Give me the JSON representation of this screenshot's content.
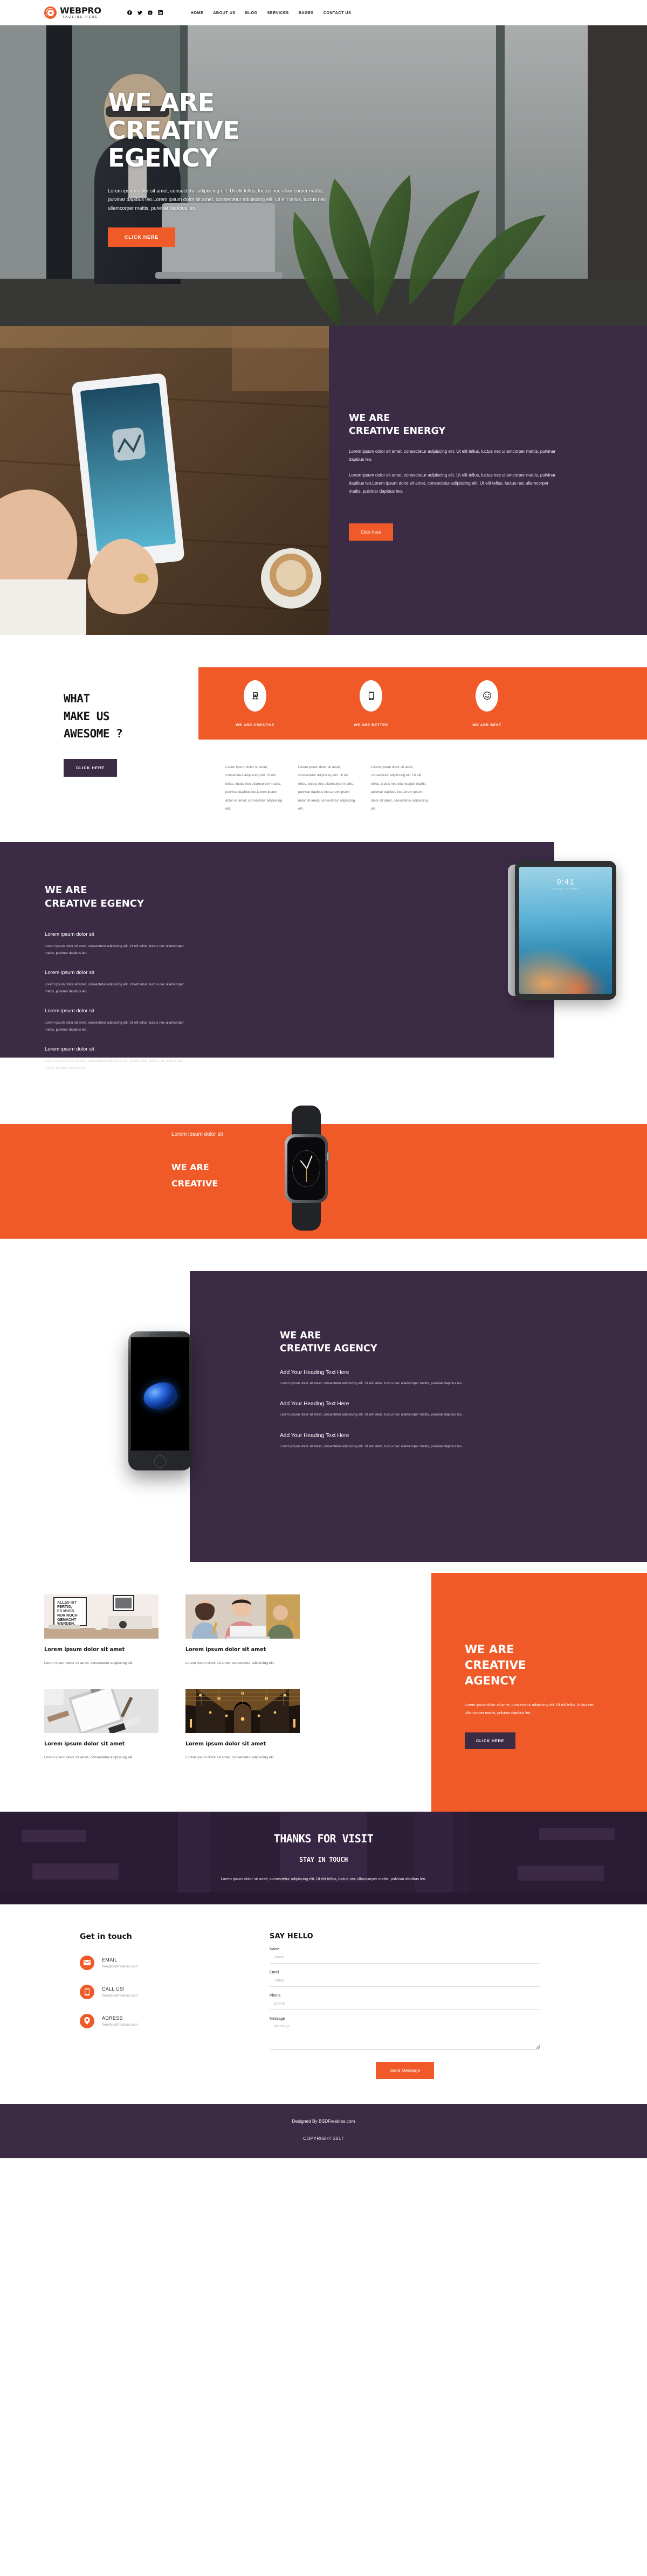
{
  "brand": {
    "name": "WEBPRO",
    "tagline": "TAGLINE HERE",
    "accent": "#f05a28",
    "dark": "#3b2b45"
  },
  "header": {
    "social": [
      "facebook-icon",
      "twitter-icon",
      "skype-icon",
      "linkedin-icon"
    ],
    "nav": [
      "HOME",
      "ABOUT US",
      "BLOG",
      "SERVICES",
      "BAGES",
      "CONTACT US"
    ]
  },
  "hero": {
    "line1": "WE ARE",
    "line2": "CREATIVE",
    "line3": "EGENCY",
    "paragraph": "Lorem ipsum dolor sit amet, consectetur adipiscing elit. Ut elit tellus, luctus nec ullamcorper mattis, pulvinar dapibus leo.Lorem ipsum dolor sit amet, consectetur adipiscing elit. Ut elit tellus, luctus nec ullamcorper mattis, pulvinar dapibus leo.",
    "button": "CLICK HERE"
  },
  "split": {
    "title_line1": "WE ARE",
    "title_line2": "CREATIVE ENERGY",
    "p1": "Lorem ipsum dolor sit amet, consectetur adipiscing elit. Ut elit tellus, luctus nec ullamcorper mattis, pulvinar dapibus leo.",
    "p2": "Lorem ipsum dolor sit amet, consectetur adipiscing elit. Ut elit tellus, luctus nec ullamcorper mattis, pulvinar dapibus leo.Lorem ipsum dolor sit amet, consectetur adipiscing elit. Ut elit tellus, luctus nec ullamcorper mattis, pulvinar dapibus leo.",
    "button": "Click here"
  },
  "awesome": {
    "title_line1": "WHAT",
    "title_line2": "MAKE US",
    "title_line3": "AWESOME ?",
    "button": "CLICK HERE",
    "features": [
      {
        "icon": "train-icon",
        "label": "WE ARE CREATIVE",
        "text": "Lorem ipsum dolor sit amet, consectetur adipiscing elit. Ut elit tellus, luctus nec ullamcorper mattis, pulvinar dapibus leo.Lorem ipsum dolor sit amet, consectetur adipiscing elit."
      },
      {
        "icon": "mobile-icon",
        "label": "WE ARE BETTER",
        "text": "Lorem ipsum dolor sit amet, consectetur adipiscing elit. Ut elit tellus, luctus nec ullamcorper mattis, pulvinar dapibus leo.Lorem ipsum dolor sit amet, consectetur adipiscing elit."
      },
      {
        "icon": "smiley-icon",
        "label": "WE ARE BEST",
        "text": "Lorem ipsum dolor sit amet, consectetur adipiscing elit. Ut elit tellus, luctus nec ullamcorper mattis, pulvinar dapibus leo.Lorem ipsum dolor sit amet, consectetur adipiscing elit."
      }
    ]
  },
  "egency": {
    "title_line1": "WE ARE",
    "title_line2": "CREATIVE EGENCY",
    "cells": [
      {
        "heading": "Lorem ipsum dolor sit",
        "text": "Lorem ipsum dolor sit amet, consectetur adipiscing elit. Ut elit tellus, luctus nec ullamcorper mattis, pulvinar dapibus leo."
      },
      {
        "heading": "Lorem ipsum dolor sit",
        "text": "Lorem ipsum dolor sit amet, consectetur adipiscing elit. Ut elit tellus, luctus nec ullamcorper mattis, pulvinar dapibus leo."
      },
      {
        "heading": "Lorem ipsum dolor sit",
        "text": "Lorem ipsum dolor sit amet, consectetur adipiscing elit. Ut elit tellus, luctus nec ullamcorper mattis, pulvinar dapibus leo."
      },
      {
        "heading": "Lorem ipsum dolor sit",
        "text": "Lorem ipsum dolor sit amet, consectetur adipiscing elit. Ut elit tellus, luctus nec ullamcorper mattis, pulvinar dapibus leo."
      }
    ],
    "tablet_time": "9:41",
    "tablet_date": "Monday, 21 March"
  },
  "watch": {
    "subtitle": "Lorem ipsum dolor sit",
    "title_line1": "WE ARE",
    "title_line2": "CREATIVE"
  },
  "phone": {
    "title_line1": "WE ARE",
    "title_line2": "CREATIVE AGENCY",
    "items": [
      {
        "heading": "Add Your Heading Text Here",
        "text": "Lorem ipsum dolor sit amet, consectetur adipiscing elit. Ut elit tellus, luctus nec ullamcorper mattis, pulvinar dapibus leo."
      },
      {
        "heading": "Add Your Heading Text Here",
        "text": "Lorem ipsum dolor sit amet, consectetur adipiscing elit. Ut elit tellus, luctus nec ullamcorper mattis, pulvinar dapibus leo."
      },
      {
        "heading": "Add Your Heading Text Here",
        "text": "Lorem ipsum dolor sit amet, consectetur adipiscing elit. Ut elit tellus, luctus nec ullamcorper mattis, pulvinar dapibus leo."
      }
    ]
  },
  "blog": {
    "posts": [
      {
        "image": "workspace-poster-photo",
        "title": "Lorem ipsum dolor sit amet",
        "text": "Lorem ipsum dolor sit amet, consectetur adipiscing elit."
      },
      {
        "image": "team-laptop-photo",
        "title": "Lorem ipsum dolor sit amet",
        "text": "Lorem ipsum dolor sit amet, consectetur adipiscing elit."
      },
      {
        "image": "stationery-mockup-photo",
        "title": "Lorem ipsum dolor sit amet",
        "text": "Lorem ipsum dolor sit amet, consectetur adipiscing elit."
      },
      {
        "image": "library-hall-photo",
        "title": "Lorem ipsum dolor sit amet",
        "text": "Lorem ipsum dolor sit amet, consectetur adipiscing elit."
      }
    ]
  },
  "cta": {
    "title_line1": "WE ARE",
    "title_line2": "CREATIVE",
    "title_line3": "AGENCY",
    "text": "Lorem ipsum dolor sit amet, consectetur adipiscing elit. Ut elit tellus, luctus nec ullamcorper mattis, pulvinar dapibus leo.",
    "button": "CLICK HERE"
  },
  "thanks": {
    "title": "THANKS FOR VISIT",
    "subtitle": "STAY IN TOUCH",
    "text": "Lorem ipsum dolor sit amet, consectetur adipiscing elit. Ut elit tellus, luctus nec ullamcorper mattis, pulvinar dapibus leo."
  },
  "contact": {
    "heading": "Get in touch",
    "items": [
      {
        "icon": "envelope-icon",
        "title": "EMAIL",
        "value": "free@psdfreebias.com"
      },
      {
        "icon": "mobile-icon",
        "title": "CALL US!",
        "value": "free@psdfreebias.com"
      },
      {
        "icon": "map-pin-icon",
        "title": "ADRESS",
        "value": "free@psdfreebias.com"
      }
    ],
    "form": {
      "heading": "SAY HELLO",
      "name_label": "Name",
      "name_placeholder": "Name",
      "email_label": "Email",
      "email_placeholder": "Email",
      "phone_label": "Phone",
      "phone_placeholder": "phone",
      "message_label": "Message",
      "message_placeholder": "Message",
      "submit": "Send Message"
    }
  },
  "footer": {
    "designed": "Designed By BSDFreebies.com",
    "copyright": "COPYRIGHT 2017"
  }
}
